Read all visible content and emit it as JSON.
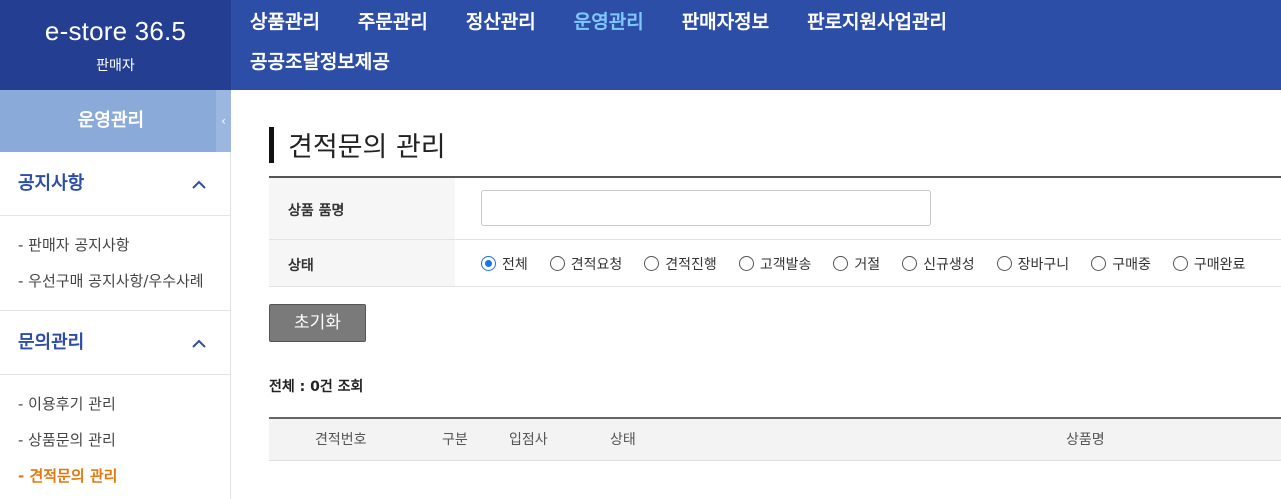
{
  "brand": {
    "title": "e-store 36.5",
    "subtitle": "판매자"
  },
  "topnav": {
    "items": [
      {
        "label": "상품관리"
      },
      {
        "label": "주문관리"
      },
      {
        "label": "정산관리"
      },
      {
        "label": "운영관리"
      },
      {
        "label": "판매자정보"
      },
      {
        "label": "판로지원사업관리"
      },
      {
        "label": "공공조달정보제공"
      }
    ],
    "active": "운영관리"
  },
  "sidebar": {
    "header": "운영관리",
    "toggle_icon": "‹",
    "sections": [
      {
        "label": "공지사항",
        "links": [
          "- 판매자 공지사항",
          "- 우선구매 공지사항/우수사례"
        ]
      },
      {
        "label": "문의관리",
        "links": [
          "- 이용후기 관리",
          "- 상품문의 관리",
          "- 견적문의 관리"
        ]
      }
    ],
    "active_link": "- 견적문의 관리"
  },
  "main": {
    "title": "견적문의 관리",
    "search": {
      "name_label": "상품 품명",
      "name_value": "",
      "status_label": "상태",
      "status_options": [
        "전체",
        "견적요청",
        "견적진행",
        "고객발송",
        "거절",
        "신규생성",
        "장바구니",
        "구매중",
        "구매완료"
      ],
      "status_selected": "전체"
    },
    "reset_label": "초기화",
    "total_label": "전체 : 0건 조회",
    "columns": [
      "견적번호",
      "구분",
      "입점사",
      "상태",
      "상품명"
    ]
  },
  "colors": {
    "header_bg": "#2d4ea7",
    "active_nav": "#7ec8ff",
    "active_link": "#e07a10",
    "radio_accent": "#1a73e8"
  }
}
